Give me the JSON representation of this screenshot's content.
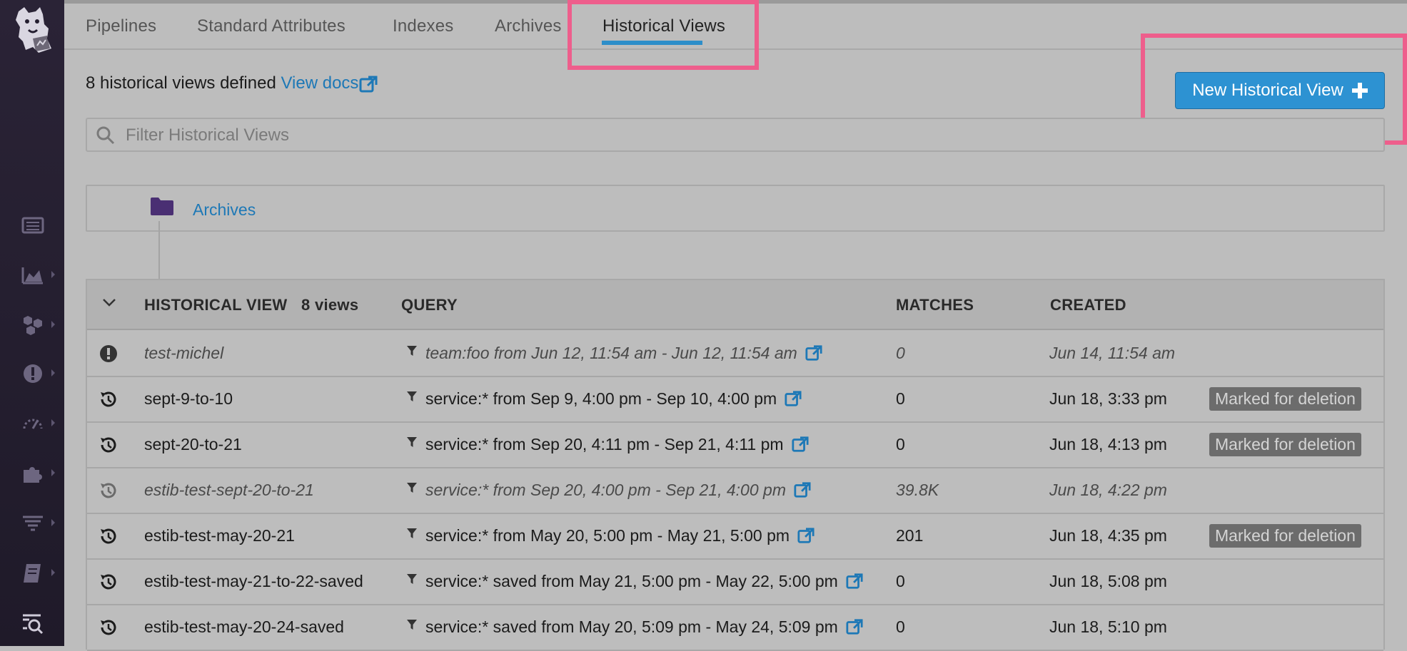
{
  "tabs": [
    {
      "label": "Pipelines",
      "active": false
    },
    {
      "label": "Standard Attributes",
      "active": false
    },
    {
      "label": "Indexes",
      "active": false
    },
    {
      "label": "Archives",
      "active": false
    },
    {
      "label": "Historical Views",
      "active": true
    }
  ],
  "header": {
    "defined_text": "8 historical views defined",
    "docs_link": "View docs",
    "new_button_label": "New Historical View"
  },
  "search": {
    "placeholder": "Filter Historical Views",
    "value": ""
  },
  "archives": {
    "label": "Archives",
    "icon": "folder-icon",
    "icon_color": "#4a2f73"
  },
  "table": {
    "columns": {
      "name": "HISTORICAL VIEW",
      "count": "8 views",
      "query": "QUERY",
      "matches": "MATCHES",
      "created": "CREATED"
    },
    "rows": [
      {
        "status_icon": "exclamation-icon",
        "name": "test-michel",
        "query": "team:foo from Jun 12, 11:54 am - Jun 12, 11:54 am",
        "matches": "0",
        "created": "Jun 14, 11:54 am",
        "badge": "",
        "dim": true
      },
      {
        "status_icon": "history-icon",
        "name": "sept-9-to-10",
        "query": "service:* from Sep 9, 4:00 pm - Sep 10, 4:00 pm",
        "matches": "0",
        "created": "Jun 18, 3:33 pm",
        "badge": "Marked for deletion",
        "dim": false
      },
      {
        "status_icon": "history-icon",
        "name": "sept-20-to-21",
        "query": "service:* from Sep 20, 4:11 pm - Sep 21, 4:11 pm",
        "matches": "0",
        "created": "Jun 18, 4:13 pm",
        "badge": "Marked for deletion",
        "dim": false
      },
      {
        "status_icon": "history-icon",
        "name": "estib-test-sept-20-to-21",
        "query": "service:* from Sep 20, 4:00 pm - Sep 21, 4:00 pm",
        "matches": "39.8K",
        "created": "Jun 18, 4:22 pm",
        "badge": "",
        "dim": true
      },
      {
        "status_icon": "history-icon",
        "name": "estib-test-may-20-21",
        "query": "service:* from May 20, 5:00 pm - May 21, 5:00 pm",
        "matches": "201",
        "created": "Jun 18, 4:35 pm",
        "badge": "Marked for deletion",
        "dim": false
      },
      {
        "status_icon": "history-icon",
        "name": "estib-test-may-21-to-22-saved",
        "query": "service:* saved from May 21, 5:00 pm - May 22, 5:00 pm",
        "matches": "0",
        "created": "Jun 18, 5:08 pm",
        "badge": "",
        "dim": false
      },
      {
        "status_icon": "history-icon",
        "name": "estib-test-may-20-24-saved",
        "query": "service:* saved from May 20, 5:09 pm - May 24, 5:09 pm",
        "matches": "0",
        "created": "Jun 18, 5:10 pm",
        "badge": "",
        "dim": false
      }
    ]
  },
  "colors": {
    "accent": "#2d8ec9",
    "link": "#1d78b6",
    "highlight": "#ee5e8c",
    "sidebar": "#241e30"
  }
}
